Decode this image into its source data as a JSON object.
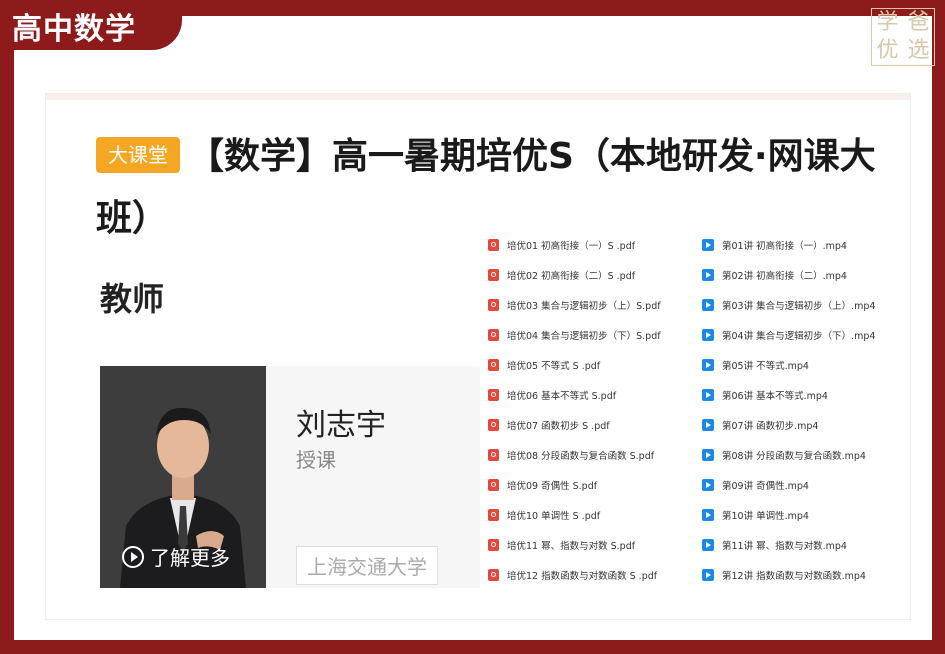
{
  "frame": {
    "title": "高中数学",
    "logo_chars": [
      "学",
      "爸",
      "优",
      "选"
    ]
  },
  "course": {
    "badge": "大课堂",
    "title": "【数学】高一暑期培优S（本地研发·网课大班）"
  },
  "teacher": {
    "heading": "教师",
    "name": "刘志宇",
    "role": "授课",
    "school": "上海交通大学",
    "more_label": "了解更多"
  },
  "files": {
    "pdf": [
      "培优01 初高衔接（一）S .pdf",
      "培优02 初高衔接（二）S .pdf",
      "培优03 集合与逻辑初步（上）S.pdf",
      "培优04 集合与逻辑初步（下）S.pdf",
      "培优05 不等式 S .pdf",
      "培优06 基本不等式 S.pdf",
      "培优07 函数初步 S .pdf",
      "培优08 分段函数与复合函数 S.pdf",
      "培优09 奇偶性 S.pdf",
      "培优10 单调性 S .pdf",
      "培优11 幂、指数与对数 S.pdf",
      "培优12 指数函数与对数函数 S .pdf"
    ],
    "mp4": [
      "第01讲 初高衔接（一）.mp4",
      "第02讲 初高衔接（二）.mp4",
      "第03讲 集合与逻辑初步（上）.mp4",
      "第04讲 集合与逻辑初步（下）.mp4",
      "第05讲 不等式.mp4",
      "第06讲 基本不等式.mp4",
      "第07讲 函数初步.mp4",
      "第08讲 分段函数与复合函数.mp4",
      "第09讲 奇偶性.mp4",
      "第10讲 单调性.mp4",
      "第11讲 幂、指数与对数.mp4",
      "第12讲 指数函数与对数函数.mp4"
    ]
  },
  "colors": {
    "frame": "#8e1b1b",
    "badge": "#f5a623",
    "pdf_icon": "#e8453c",
    "mp4_icon": "#1e88e5"
  }
}
